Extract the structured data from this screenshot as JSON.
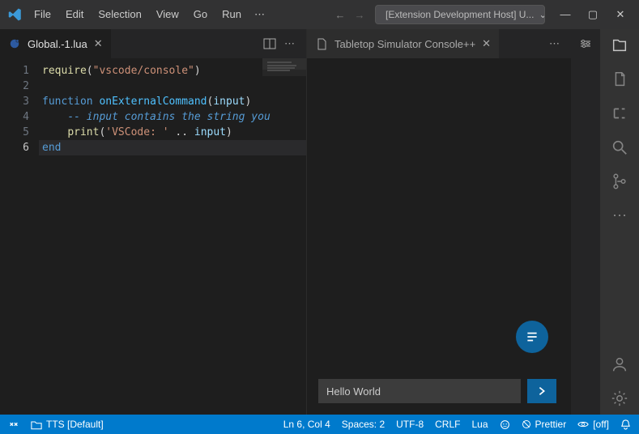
{
  "titlebar": {
    "menu": [
      "File",
      "Edit",
      "Selection",
      "View",
      "Go",
      "Run"
    ],
    "search_text": "[Extension Development Host] U..."
  },
  "left_pane": {
    "tab_label": "Global.-1.lua",
    "line_numbers": [
      "1",
      "2",
      "3",
      "4",
      "5",
      "6"
    ],
    "code_lines": [
      [
        [
          "fn",
          "require"
        ],
        [
          "pn",
          "("
        ],
        [
          "str",
          "\"vscode/console\""
        ],
        [
          "pn",
          ")"
        ]
      ],
      [],
      [
        [
          "key",
          "function"
        ],
        [
          "pn",
          " "
        ],
        [
          "funcname",
          "onExternalCommand"
        ],
        [
          "pn",
          "("
        ],
        [
          "id",
          "input"
        ],
        [
          "pn",
          ")"
        ]
      ],
      [
        [
          "pn",
          "    "
        ],
        [
          "cmt",
          "-- input contains the string you "
        ]
      ],
      [
        [
          "pn",
          "    "
        ],
        [
          "fn",
          "print"
        ],
        [
          "pn",
          "("
        ],
        [
          "str",
          "'VSCode: '"
        ],
        [
          "pn",
          " .. "
        ],
        [
          "id",
          "input"
        ],
        [
          "pn",
          ")"
        ]
      ],
      [
        [
          "key",
          "end"
        ]
      ]
    ],
    "current_line_index": 5
  },
  "right_pane": {
    "tab_label": "Tabletop Simulator Console++",
    "input_value": "Hello World"
  },
  "statusbar": {
    "folder": "TTS [Default]",
    "cursor": "Ln 6, Col 4",
    "spaces": "Spaces: 2",
    "encoding": "UTF-8",
    "eol": "CRLF",
    "language": "Lua",
    "prettier": "Prettier",
    "eye": "[off]"
  }
}
